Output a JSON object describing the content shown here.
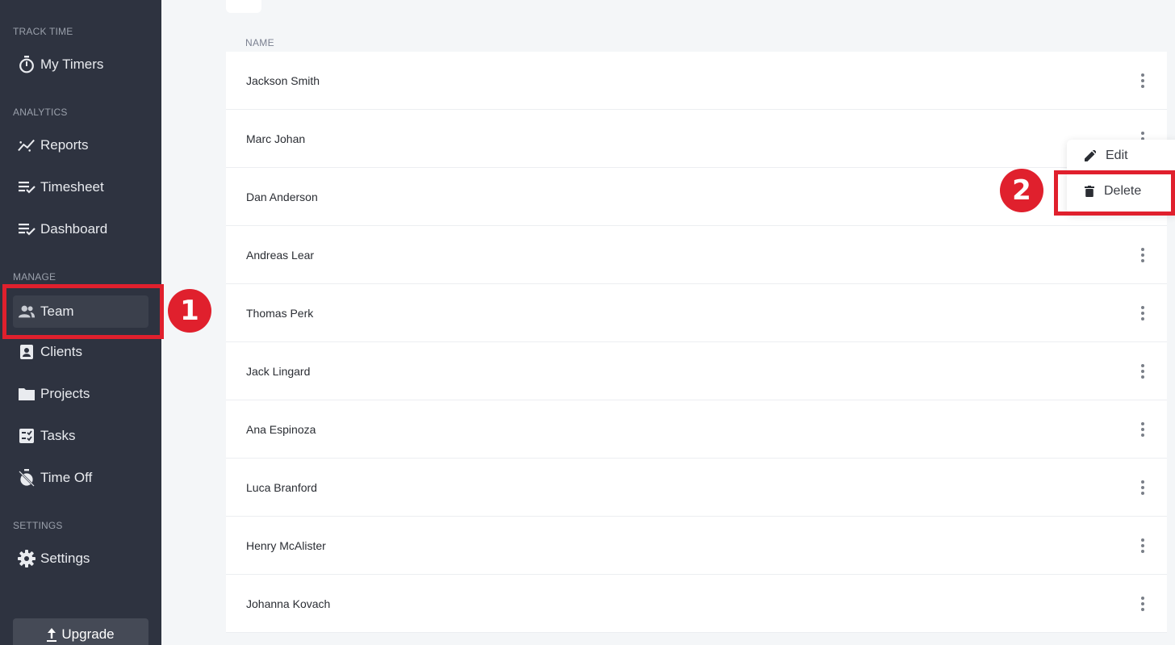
{
  "sidebar": {
    "sections": {
      "track_time": "TRACK TIME",
      "analytics": "ANALYTICS",
      "manage": "MANAGE",
      "settings": "SETTINGS"
    },
    "items": [
      {
        "label": "My Timers",
        "icon": "stopwatch-icon"
      },
      {
        "label": "Reports",
        "icon": "trend-chart-icon"
      },
      {
        "label": "Timesheet",
        "icon": "list-check-icon"
      },
      {
        "label": "Dashboard",
        "icon": "list-check-icon"
      },
      {
        "label": "Team",
        "icon": "people-icon",
        "active": true
      },
      {
        "label": "Clients",
        "icon": "contact-card-icon"
      },
      {
        "label": "Projects",
        "icon": "folder-icon"
      },
      {
        "label": "Tasks",
        "icon": "checklist-icon"
      },
      {
        "label": "Time Off",
        "icon": "timer-off-icon"
      },
      {
        "label": "Settings",
        "icon": "gear-icon"
      }
    ],
    "upgrade_label": "Upgrade"
  },
  "table": {
    "column_header": "NAME",
    "rows": [
      "Jackson Smith",
      "Marc Johan",
      "Dan Anderson",
      "Andreas Lear",
      "Thomas Perk",
      "Jack Lingard",
      "Ana Espinoza",
      "Luca Branford",
      "Henry McAlister",
      "Johanna Kovach"
    ]
  },
  "row_menu": {
    "edit_label": "Edit",
    "delete_label": "Delete"
  },
  "annotations": {
    "step1": "1",
    "step2": "2"
  },
  "colors": {
    "sidebar_bg": "#2e3340",
    "highlight_red": "#e0202d",
    "page_bg": "#f4f6f8"
  }
}
